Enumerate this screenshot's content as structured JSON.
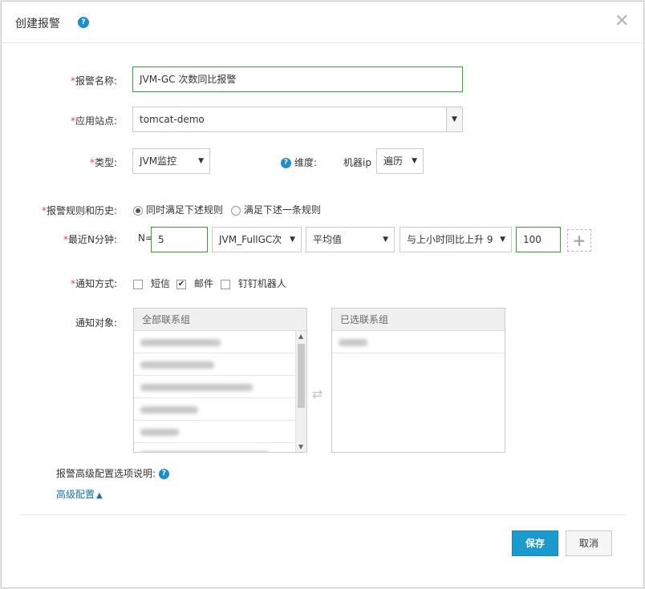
{
  "dialog": {
    "title": "创建报警",
    "help_icon": "question-circle-icon",
    "close_icon": "close-icon"
  },
  "form": {
    "name": {
      "label": "报警名称:",
      "value": "JVM-GC 次数同比报警"
    },
    "site": {
      "label": "应用站点:",
      "value": "tomcat-demo"
    },
    "type": {
      "label": "类型:",
      "value": "JVM监控"
    },
    "dimension": {
      "label": "维度:",
      "sub_label": "机器ip",
      "value": "遍历"
    },
    "rule_history": {
      "label": "报警规则和历史:",
      "options": [
        "同时满足下述规则",
        "满足下述一条规则"
      ],
      "selected_index": 0
    },
    "recent_n": {
      "label": "最近N分钟:",
      "n_label": "N=",
      "n_value": "5",
      "metric": "JVM_FullGC次",
      "aggregate": "平均值",
      "compare": "与上小时同比上升 9",
      "threshold": "100",
      "add_icon": "plus-icon"
    },
    "notify": {
      "label": "通知方式:",
      "options": [
        {
          "label": "短信",
          "checked": false
        },
        {
          "label": "邮件",
          "checked": true
        },
        {
          "label": "钉钉机器人",
          "checked": false
        }
      ]
    },
    "targets": {
      "label": "通知对象:",
      "all_header": "全部联系组",
      "selected_header": "已选联系组",
      "transfer_icon": "transfer-arrows-icon"
    },
    "advanced": {
      "desc_label": "报警高级配置选项说明:",
      "toggle_label": "高级配置"
    }
  },
  "footer": {
    "save_label": "保存",
    "cancel_label": "取消"
  },
  "colors": {
    "primary": "#1a9acd",
    "required": "#e0454f",
    "focus_border": "#3b9d3b",
    "link": "#1b6fae"
  }
}
